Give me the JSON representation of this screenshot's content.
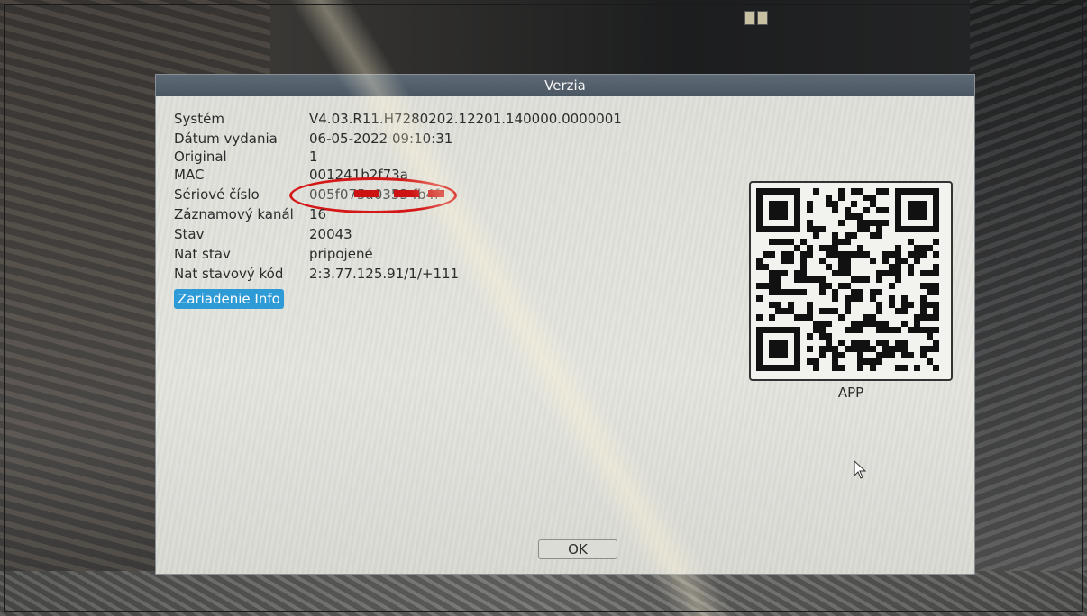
{
  "dialog": {
    "title": "Verzia",
    "rows": [
      {
        "label": "Systém",
        "value": "V4.03.R11.H7280202.12201.140000.0000001"
      },
      {
        "label": "Dátum vydania",
        "value": "06-05-2022 09:10:31"
      },
      {
        "label": "Original",
        "value": "1"
      },
      {
        "label": "MAC",
        "value": "001241b2f73a"
      },
      {
        "label": "Sériové číslo",
        "value": "005f075a0353 fb4f"
      },
      {
        "label": "Záznamový kanál",
        "value": "16"
      },
      {
        "label": "Stav",
        "value": "20043"
      },
      {
        "label": "Nat stav",
        "value": "pripojené"
      },
      {
        "label": "Nat stavový kód",
        "value": "2:3.77.125.91/1/+111"
      }
    ],
    "device_info_button": "Zariadenie Info",
    "qr_caption": "APP",
    "ok_button": "OK"
  },
  "colors": {
    "titlebar": "#4f5b67",
    "button_active": "#2e9ad6",
    "annotation_red": "#d41818"
  },
  "icons": {
    "qr": "qr-code-icon",
    "cursor": "mouse-pointer-icon"
  }
}
